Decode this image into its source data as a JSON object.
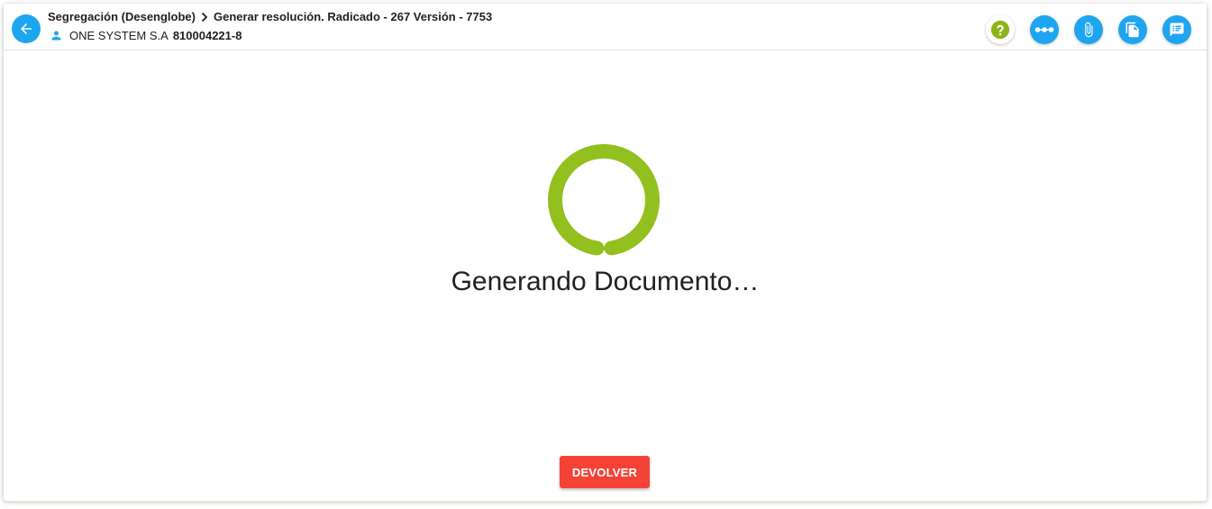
{
  "header": {
    "breadcrumb_parent": "Segregación (Desenglobe)",
    "breadcrumb_current": "Generar resolución. Radicado - 267 Versión - 7753",
    "company_name": "ONE SYSTEM S.A",
    "company_nit": "810004221-8",
    "icons": {
      "back": "arrow-left-icon",
      "separator": "chevron-right-icon",
      "user": "person-icon"
    }
  },
  "actions": [
    {
      "name": "help",
      "icon": "question-circle-icon"
    },
    {
      "name": "flow",
      "icon": "timeline-dots-icon"
    },
    {
      "name": "attachments",
      "icon": "paperclip-icon"
    },
    {
      "name": "documents",
      "icon": "copy-document-icon"
    },
    {
      "name": "comments",
      "icon": "comment-list-icon"
    }
  ],
  "main": {
    "loading_text": "Generando Documento…",
    "return_button_label": "DEVOLVER"
  },
  "colors": {
    "primary_blue": "#1ea5ef",
    "loader_green": "#93c01f",
    "danger_red": "#f44336",
    "help_green": "#8cb41b"
  }
}
